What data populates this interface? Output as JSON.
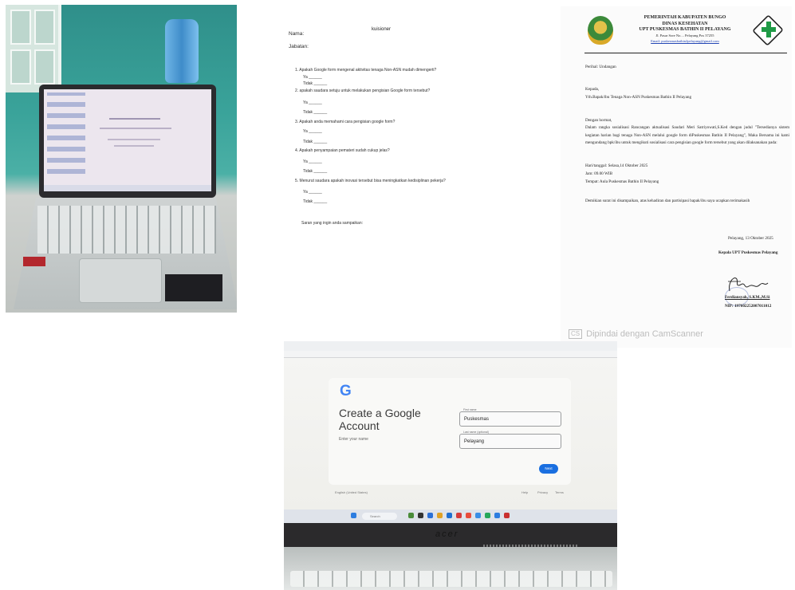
{
  "questionnaire": {
    "title": "kuisioner",
    "nama_label": "Nama:",
    "jabatan_label": "Jabatan:",
    "questions": [
      {
        "text": "1.  Apakah Google form mengenal aktivitas tenaga Non-ASN mudah dimengerti?",
        "yes": "Ya ______",
        "no": "Tidak ______"
      },
      {
        "text": "2.  apakah saudara setuju untuk melakukan pengisian Google form tersebut?",
        "yes": "Ya ______",
        "no": "Tidak ______"
      },
      {
        "text": "3.  Apakah anda memahami cara pengisian google form?",
        "yes": "Ya ______",
        "no": "Tidak ______"
      },
      {
        "text": "4.  Apakah penyampaian pemateri sudah cukup jelas?",
        "yes": "Ya ______",
        "no": "Tidak ______"
      },
      {
        "text": "5.  Menurut saudara apakah inovasi tersebut bisa meningkatkan kedisiplinan pekerja?",
        "yes": "Ya ______",
        "no": "Tidak ______"
      }
    ],
    "saran_label": "Saran yang ingin anda sampaikan:"
  },
  "letter": {
    "head1": "PEMERINTAH KABUPATEN BUNGO",
    "head2": "DINAS KESEHATAN",
    "head3": "UPT  PUSKESMAS  BATHIN II  PELAYANG",
    "address": "Jl. Pasar Sore No.... Pelayang  Pos 37255",
    "email": "Email: puskesmasbathin2pelayang@gmail.com",
    "perihal": "Perihal: Undangan",
    "kepada": "Kepada,",
    "yth": "Yth.Bapak/ibu Tenaga Non-ASN Puskesmas Bathin II Pelayang",
    "salam": "Dengan hormat,",
    "body": "Dalam rangka sosialisasi Rancangan aktualisasi Saudari Meri Satriyowati,S.Ked dengan judul \"Tersedianya sistem kegiatan harian bagi tenaga Non-ASN melalui google form diPuskesmas Bathin II Pelayang\", Maka Bersama ini kami mengundang bpk/ibu untuk mengikuti sosialisasi cara pengisian google form tersebut yang akan dilaksanakan pada:",
    "hari": "Hari/tanggal: Selasa,14 Oktober 2025",
    "jam": "Jam: 09.00 WIB",
    "tempat": "Tempat: Aula Puskesmas Bathin II Pelayang",
    "penutup": "Demikian surat ini disampaikan, atas kehadiran dan partisipasi bapak/ibu saya ucapkan terimakasih",
    "date": "Pelayang, 13 Oktober 2025",
    "position": "Kepala UPT Puskesmas Pelayang",
    "signer": "Ferdiansyah, S.KM.,M.Si",
    "nip": "NIP: 197602252007011012"
  },
  "camscanner": {
    "icon": "CS",
    "text": "Dipindai dengan CamScanner"
  },
  "google": {
    "logo": "G",
    "title": "Create a Google Account",
    "subtitle": "Enter your name",
    "first_label": "First name",
    "first_value": "Puskesmas",
    "last_label": "Last name (optional)",
    "last_value": "Pelayang",
    "next": "Next",
    "language": "English (United States)",
    "help": "Help",
    "privacy": "Privacy",
    "terms": "Terms",
    "search": "Search",
    "laptop_brand": "acer"
  }
}
